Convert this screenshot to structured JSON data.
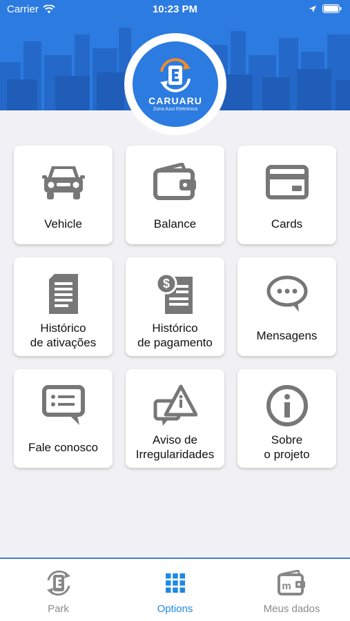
{
  "status_bar": {
    "carrier": "Carrier",
    "time": "10:23 PM"
  },
  "logo": {
    "brand": "CARUARU",
    "tagline": "Zona Azul Eletrônica"
  },
  "menu": [
    {
      "label": "Vehicle",
      "icon": "car-icon"
    },
    {
      "label": "Balance",
      "icon": "wallet-icon"
    },
    {
      "label": "Cards",
      "icon": "credit-card-icon"
    },
    {
      "label": "Histórico\nde ativações",
      "icon": "document-icon"
    },
    {
      "label": "Histórico\nde pagamento",
      "icon": "payment-document-icon"
    },
    {
      "label": "Mensagens",
      "icon": "chat-bubble-icon"
    },
    {
      "label": "Fale conosco",
      "icon": "message-icon"
    },
    {
      "label": "Aviso de\nIrregularidades",
      "icon": "warning-message-icon"
    },
    {
      "label": "Sobre\no projeto",
      "icon": "info-icon"
    }
  ],
  "tabs": [
    {
      "label": "Park",
      "icon": "park-logo-icon",
      "active": false
    },
    {
      "label": "Options",
      "icon": "grid-icon",
      "active": true
    },
    {
      "label": "Meus dados",
      "icon": "wallet-id-icon",
      "active": false
    }
  ],
  "colors": {
    "header_blue": "#2c7be0",
    "active_tab": "#1e88e5",
    "icon_gray": "#777777"
  }
}
